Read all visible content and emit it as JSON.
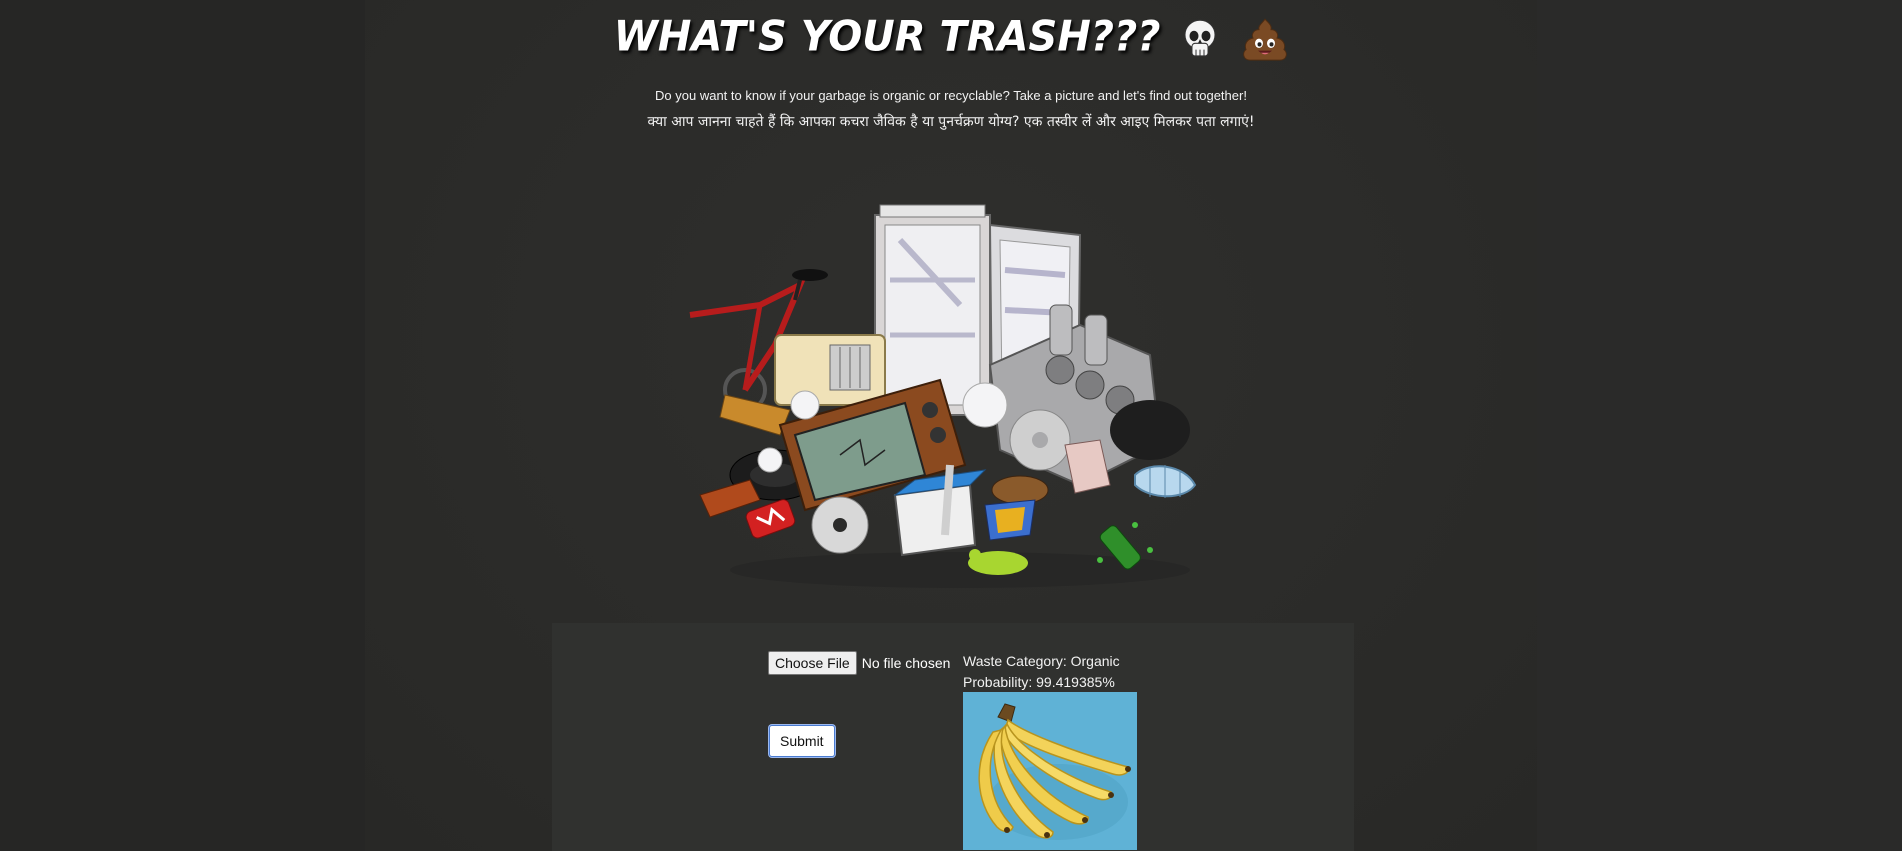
{
  "header": {
    "title": "WHAT'S YOUR TRASH???",
    "title_emojis": [
      "skull-icon",
      "pile-of-poo-icon"
    ]
  },
  "intro": {
    "english": "Do you want to know if your garbage is organic or recyclable? Take a picture and let's find out together!",
    "hindi": "क्या आप जानना चाहते हैं कि आपका कचरा जैविक है या पुनर्चक्रण योग्य? एक तस्वीर लें और आइए मिलकर पता लगाएं!"
  },
  "upload": {
    "choose_label": "Choose File",
    "file_status": "No file chosen",
    "submit_label": "Submit"
  },
  "result": {
    "category_line": "Waste Category: Organic",
    "probability_line": "Probability: 99.419385%"
  },
  "colors": {
    "background": "#2b2b2a",
    "panel": "#30312f",
    "result_image_bg": "#5fb0d3"
  }
}
